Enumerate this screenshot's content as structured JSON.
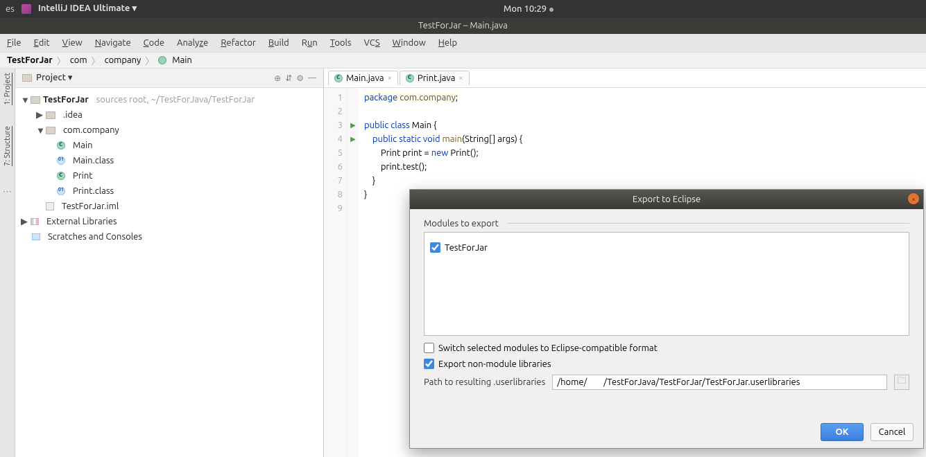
{
  "os": {
    "left": "es",
    "app": "IntelliJ IDEA Ultimate ▾",
    "time": "Mon 10:29"
  },
  "title": "TestForJar – Main.java",
  "menu": [
    "File",
    "Edit",
    "View",
    "Navigate",
    "Code",
    "Analyze",
    "Refactor",
    "Build",
    "Run",
    "Tools",
    "VCS",
    "Window",
    "Help"
  ],
  "crumbs": [
    "TestForJar",
    "com",
    "company",
    "Main"
  ],
  "project": {
    "label": "Project ▾",
    "root": "TestForJar",
    "rootnote": "sources root,  ~/TestForJava/TestForJar",
    "idea": ".idea",
    "pkg": "com.company",
    "files": [
      "Main",
      "Main.class",
      "Print",
      "Print.class"
    ],
    "iml": "TestForJar.iml",
    "ext": "External Libraries",
    "scr": "Scratches and Consoles"
  },
  "rails": {
    "proj": "1: Project",
    "struct": "7: Structure"
  },
  "tabs": [
    {
      "name": "Main.java",
      "active": true
    },
    {
      "name": "Print.java",
      "active": false
    }
  ],
  "code_lines": [
    1,
    2,
    3,
    4,
    5,
    6,
    7,
    8,
    9
  ],
  "dialog": {
    "title": "Export to Eclipse",
    "modules_label": "Modules to export",
    "module": "TestForJar",
    "switch": "Switch selected modules to Eclipse-compatible format",
    "export_libs": "Export non-module libraries",
    "path_label": "Path to resulting .userlibraries",
    "path_value": "/home/        /TestForJava/TestForJar/TestForJar.userlibraries",
    "ok": "OK",
    "cancel": "Cancel"
  }
}
